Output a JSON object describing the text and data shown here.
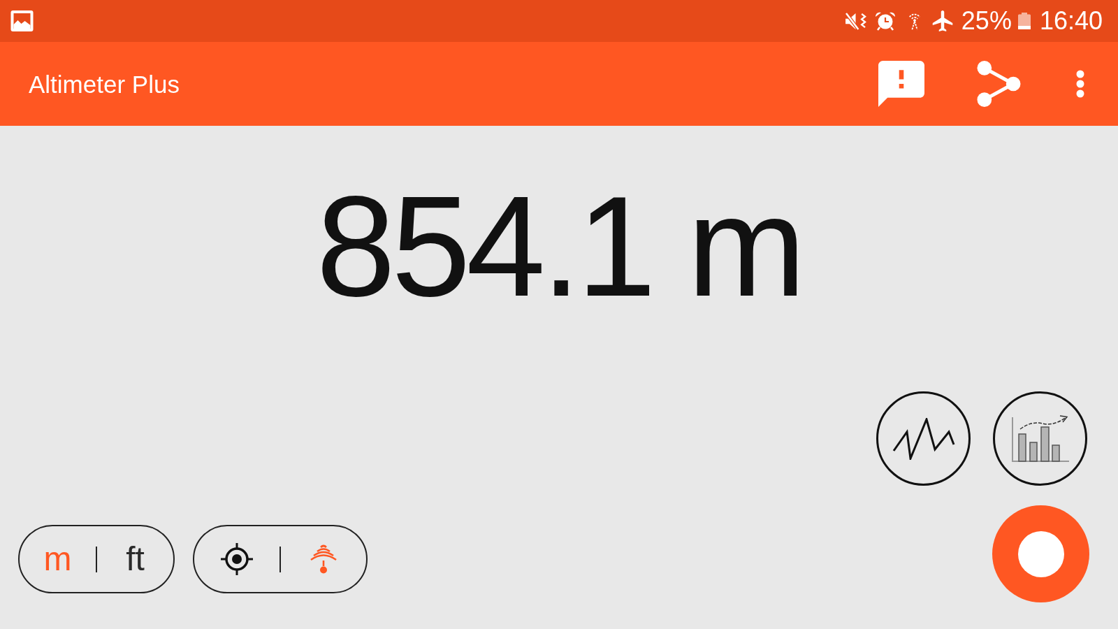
{
  "status_bar": {
    "battery": "25%",
    "time": "16:40"
  },
  "app_bar": {
    "title": "Altimeter Plus"
  },
  "altitude": {
    "reading": "854.1 m"
  },
  "unit_toggle": [
    {
      "label": "m",
      "selected": true
    },
    {
      "label": "ft",
      "selected": false
    }
  ],
  "source_toggle": [
    {
      "kind": "gps",
      "selected": false
    },
    {
      "kind": "barometer",
      "selected": true
    }
  ]
}
